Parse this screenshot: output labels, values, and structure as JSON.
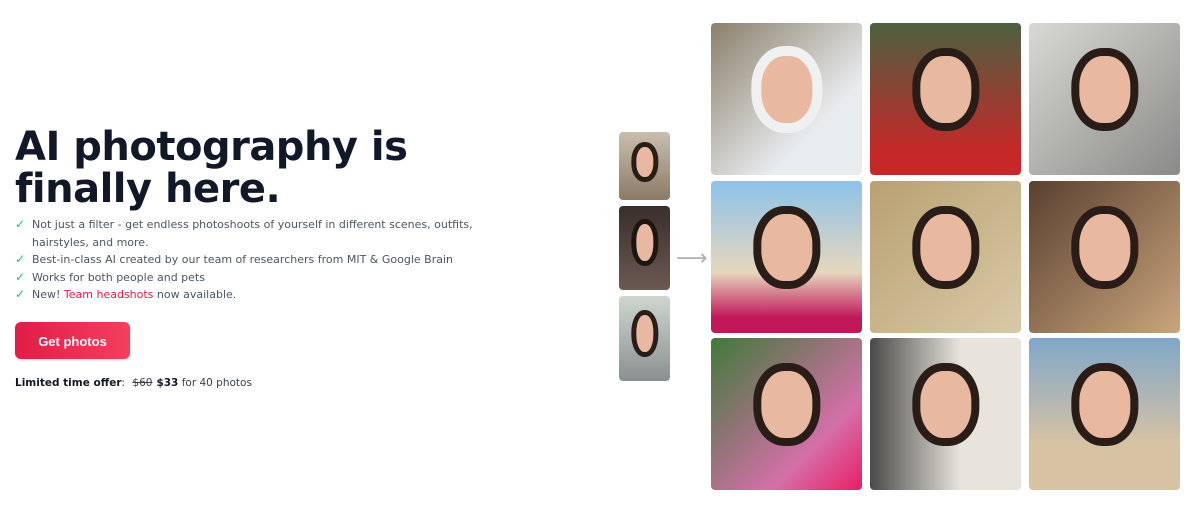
{
  "hero": {
    "title_line1": "AI photography is",
    "title_line2": "finally here.",
    "features": [
      {
        "text": "Not just a filter - get endless photoshoots of yourself in different scenes, outfits, hairstyles, and more."
      },
      {
        "text": "Best-in-class AI created by our team of researchers from MIT & Google Brain"
      },
      {
        "text": "Works for both people and pets"
      },
      {
        "prefix": "New! ",
        "link": "Team headshots",
        "suffix": " now available."
      }
    ],
    "cta_label": "Get photos",
    "offer": {
      "label": "Limited time offer",
      "colon": ":",
      "old_price": "$60",
      "new_price": "$33",
      "detail": "for 40 photos"
    }
  },
  "icons": {
    "check": "check-icon",
    "arrow": "arrow-right-icon"
  },
  "colors": {
    "accent": "#e11d48",
    "check": "#22c55e",
    "heading": "#111827"
  }
}
